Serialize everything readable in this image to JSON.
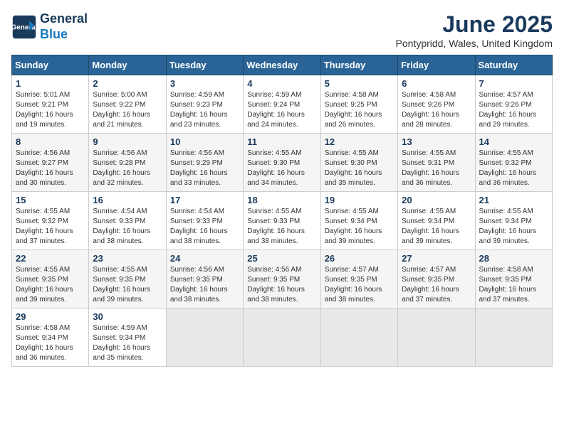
{
  "logo": {
    "line1": "General",
    "line2": "Blue"
  },
  "title": "June 2025",
  "location": "Pontypridd, Wales, United Kingdom",
  "days_of_week": [
    "Sunday",
    "Monday",
    "Tuesday",
    "Wednesday",
    "Thursday",
    "Friday",
    "Saturday"
  ],
  "weeks": [
    [
      {
        "day": "1",
        "sunrise": "Sunrise: 5:01 AM",
        "sunset": "Sunset: 9:21 PM",
        "daylight": "Daylight: 16 hours and 19 minutes."
      },
      {
        "day": "2",
        "sunrise": "Sunrise: 5:00 AM",
        "sunset": "Sunset: 9:22 PM",
        "daylight": "Daylight: 16 hours and 21 minutes."
      },
      {
        "day": "3",
        "sunrise": "Sunrise: 4:59 AM",
        "sunset": "Sunset: 9:23 PM",
        "daylight": "Daylight: 16 hours and 23 minutes."
      },
      {
        "day": "4",
        "sunrise": "Sunrise: 4:59 AM",
        "sunset": "Sunset: 9:24 PM",
        "daylight": "Daylight: 16 hours and 24 minutes."
      },
      {
        "day": "5",
        "sunrise": "Sunrise: 4:58 AM",
        "sunset": "Sunset: 9:25 PM",
        "daylight": "Daylight: 16 hours and 26 minutes."
      },
      {
        "day": "6",
        "sunrise": "Sunrise: 4:58 AM",
        "sunset": "Sunset: 9:26 PM",
        "daylight": "Daylight: 16 hours and 28 minutes."
      },
      {
        "day": "7",
        "sunrise": "Sunrise: 4:57 AM",
        "sunset": "Sunset: 9:26 PM",
        "daylight": "Daylight: 16 hours and 29 minutes."
      }
    ],
    [
      {
        "day": "8",
        "sunrise": "Sunrise: 4:56 AM",
        "sunset": "Sunset: 9:27 PM",
        "daylight": "Daylight: 16 hours and 30 minutes."
      },
      {
        "day": "9",
        "sunrise": "Sunrise: 4:56 AM",
        "sunset": "Sunset: 9:28 PM",
        "daylight": "Daylight: 16 hours and 32 minutes."
      },
      {
        "day": "10",
        "sunrise": "Sunrise: 4:56 AM",
        "sunset": "Sunset: 9:29 PM",
        "daylight": "Daylight: 16 hours and 33 minutes."
      },
      {
        "day": "11",
        "sunrise": "Sunrise: 4:55 AM",
        "sunset": "Sunset: 9:30 PM",
        "daylight": "Daylight: 16 hours and 34 minutes."
      },
      {
        "day": "12",
        "sunrise": "Sunrise: 4:55 AM",
        "sunset": "Sunset: 9:30 PM",
        "daylight": "Daylight: 16 hours and 35 minutes."
      },
      {
        "day": "13",
        "sunrise": "Sunrise: 4:55 AM",
        "sunset": "Sunset: 9:31 PM",
        "daylight": "Daylight: 16 hours and 36 minutes."
      },
      {
        "day": "14",
        "sunrise": "Sunrise: 4:55 AM",
        "sunset": "Sunset: 9:32 PM",
        "daylight": "Daylight: 16 hours and 36 minutes."
      }
    ],
    [
      {
        "day": "15",
        "sunrise": "Sunrise: 4:55 AM",
        "sunset": "Sunset: 9:32 PM",
        "daylight": "Daylight: 16 hours and 37 minutes."
      },
      {
        "day": "16",
        "sunrise": "Sunrise: 4:54 AM",
        "sunset": "Sunset: 9:33 PM",
        "daylight": "Daylight: 16 hours and 38 minutes."
      },
      {
        "day": "17",
        "sunrise": "Sunrise: 4:54 AM",
        "sunset": "Sunset: 9:33 PM",
        "daylight": "Daylight: 16 hours and 38 minutes."
      },
      {
        "day": "18",
        "sunrise": "Sunrise: 4:55 AM",
        "sunset": "Sunset: 9:33 PM",
        "daylight": "Daylight: 16 hours and 38 minutes."
      },
      {
        "day": "19",
        "sunrise": "Sunrise: 4:55 AM",
        "sunset": "Sunset: 9:34 PM",
        "daylight": "Daylight: 16 hours and 39 minutes."
      },
      {
        "day": "20",
        "sunrise": "Sunrise: 4:55 AM",
        "sunset": "Sunset: 9:34 PM",
        "daylight": "Daylight: 16 hours and 39 minutes."
      },
      {
        "day": "21",
        "sunrise": "Sunrise: 4:55 AM",
        "sunset": "Sunset: 9:34 PM",
        "daylight": "Daylight: 16 hours and 39 minutes."
      }
    ],
    [
      {
        "day": "22",
        "sunrise": "Sunrise: 4:55 AM",
        "sunset": "Sunset: 9:35 PM",
        "daylight": "Daylight: 16 hours and 39 minutes."
      },
      {
        "day": "23",
        "sunrise": "Sunrise: 4:55 AM",
        "sunset": "Sunset: 9:35 PM",
        "daylight": "Daylight: 16 hours and 39 minutes."
      },
      {
        "day": "24",
        "sunrise": "Sunrise: 4:56 AM",
        "sunset": "Sunset: 9:35 PM",
        "daylight": "Daylight: 16 hours and 38 minutes."
      },
      {
        "day": "25",
        "sunrise": "Sunrise: 4:56 AM",
        "sunset": "Sunset: 9:35 PM",
        "daylight": "Daylight: 16 hours and 38 minutes."
      },
      {
        "day": "26",
        "sunrise": "Sunrise: 4:57 AM",
        "sunset": "Sunset: 9:35 PM",
        "daylight": "Daylight: 16 hours and 38 minutes."
      },
      {
        "day": "27",
        "sunrise": "Sunrise: 4:57 AM",
        "sunset": "Sunset: 9:35 PM",
        "daylight": "Daylight: 16 hours and 37 minutes."
      },
      {
        "day": "28",
        "sunrise": "Sunrise: 4:58 AM",
        "sunset": "Sunset: 9:35 PM",
        "daylight": "Daylight: 16 hours and 37 minutes."
      }
    ],
    [
      {
        "day": "29",
        "sunrise": "Sunrise: 4:58 AM",
        "sunset": "Sunset: 9:34 PM",
        "daylight": "Daylight: 16 hours and 36 minutes."
      },
      {
        "day": "30",
        "sunrise": "Sunrise: 4:59 AM",
        "sunset": "Sunset: 9:34 PM",
        "daylight": "Daylight: 16 hours and 35 minutes."
      },
      null,
      null,
      null,
      null,
      null
    ]
  ]
}
